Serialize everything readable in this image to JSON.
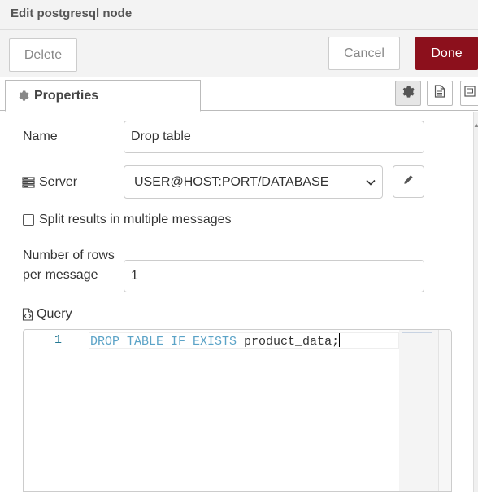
{
  "header": {
    "title": "Edit postgresql node"
  },
  "toolbar": {
    "delete_label": "Delete",
    "cancel_label": "Cancel",
    "done_label": "Done"
  },
  "tabs": {
    "properties_label": "Properties",
    "icons": [
      "gear-icon",
      "document-icon",
      "layout-icon"
    ]
  },
  "form": {
    "name": {
      "label": "Name",
      "value": "Drop table"
    },
    "server": {
      "label": "Server",
      "selected": "USER@HOST:PORT/DATABASE"
    },
    "split": {
      "label": "Split results in multiple messages",
      "checked": false
    },
    "rows": {
      "label_line1": "Number of rows",
      "label_line2": "per message",
      "value": "1"
    },
    "query": {
      "label": "Query",
      "line_number": "1",
      "keywords": "DROP TABLE IF EXISTS",
      "identifier": "product_data;"
    }
  },
  "colors": {
    "done_button": "#8c101c",
    "keyword": "#5ba3c7",
    "line_number": "#237893"
  }
}
